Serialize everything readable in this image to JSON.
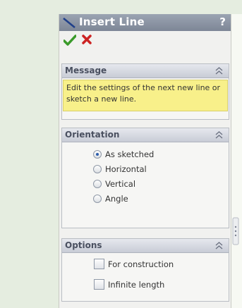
{
  "panel": {
    "title": "Insert Line",
    "help_label": "?",
    "ok_icon": "checkmark-icon",
    "cancel_icon": "x-icon"
  },
  "message": {
    "title": "Message",
    "text": "Edit the settings of the next new line or sketch a new line."
  },
  "orientation": {
    "title": "Orientation",
    "options": [
      {
        "label": "As sketched",
        "checked": true
      },
      {
        "label": "Horizontal",
        "checked": false
      },
      {
        "label": "Vertical",
        "checked": false
      },
      {
        "label": "Angle",
        "checked": false
      }
    ]
  },
  "options": {
    "title": "Options",
    "items": [
      {
        "label": "For construction",
        "checked": false
      },
      {
        "label": "Infinite length",
        "checked": false
      }
    ]
  },
  "colors": {
    "title_bar": "#8a93a3",
    "message_bg": "#f8f08a",
    "ok_green": "#3a9a2a",
    "cancel_red": "#cc2222"
  }
}
